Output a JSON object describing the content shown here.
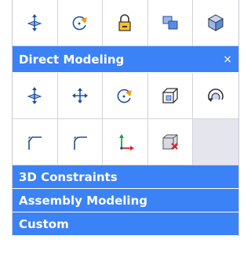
{
  "top_toolbar": {
    "tools": [
      {
        "icon": "move-face-icon"
      },
      {
        "icon": "rotate-icon"
      },
      {
        "icon": "lock-icon"
      },
      {
        "icon": "layers-icon"
      },
      {
        "icon": "part-cube-icon"
      }
    ]
  },
  "direct_modeling": {
    "title": "Direct Modeling",
    "close_label": "×",
    "row1": [
      {
        "icon": "move-face-icon"
      },
      {
        "icon": "move-arrows-icon"
      },
      {
        "icon": "rotate-icon"
      },
      {
        "icon": "box-frame-icon"
      },
      {
        "icon": "revolve-icon"
      }
    ],
    "row2": [
      {
        "icon": "fillet-edge-icon"
      },
      {
        "icon": "round-edge-icon"
      },
      {
        "icon": "axis-icon"
      },
      {
        "icon": "delete-face-icon"
      }
    ]
  },
  "sections": [
    {
      "title": "3D Constraints"
    },
    {
      "title": "Assembly Modeling"
    },
    {
      "title": "Custom"
    }
  ],
  "colors": {
    "header_blue": "#3b82f6",
    "icon_blue": "#1f4fa3",
    "icon_orange": "#f59e0b",
    "icon_red": "#dc2626",
    "icon_green": "#16a34a"
  }
}
